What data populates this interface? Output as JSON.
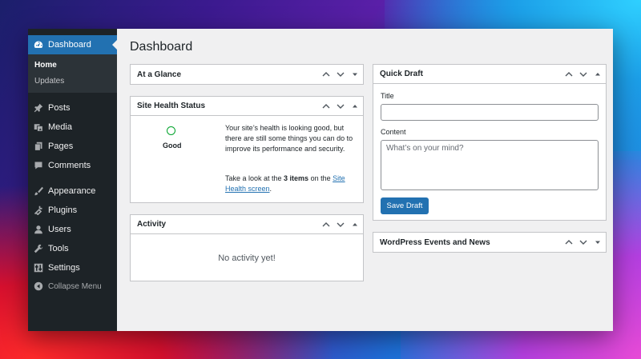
{
  "sidebar": {
    "dashboard_label": "Dashboard",
    "submenu": [
      {
        "label": "Home",
        "current": true
      },
      {
        "label": "Updates",
        "current": false
      }
    ],
    "items": [
      {
        "label": "Posts",
        "icon": "pin-icon"
      },
      {
        "label": "Media",
        "icon": "media-icon"
      },
      {
        "label": "Pages",
        "icon": "pages-icon"
      },
      {
        "label": "Comments",
        "icon": "comment-icon"
      },
      {
        "label": "Appearance",
        "icon": "brush-icon"
      },
      {
        "label": "Plugins",
        "icon": "plug-icon"
      },
      {
        "label": "Users",
        "icon": "user-icon"
      },
      {
        "label": "Tools",
        "icon": "wrench-icon"
      },
      {
        "label": "Settings",
        "icon": "settings-icon"
      }
    ],
    "collapse_label": "Collapse Menu"
  },
  "page": {
    "title": "Dashboard"
  },
  "widgets": {
    "glance": {
      "title": "At a Glance"
    },
    "health": {
      "title": "Site Health Status",
      "status": "Good",
      "message": "Your site’s health is looking good, but there are still some things you can do to improve its performance and security.",
      "link_prefix": "Take a look at the ",
      "items_count": "3 items",
      "link_mid": " on the ",
      "link_text": "Site Health screen",
      "link_suffix": "."
    },
    "activity": {
      "title": "Activity",
      "empty": "No activity yet!"
    },
    "quick_draft": {
      "title": "Quick Draft",
      "title_label": "Title",
      "title_value": "",
      "content_label": "Content",
      "content_placeholder": "What’s on your mind?",
      "save_label": "Save Draft"
    },
    "events": {
      "title": "WordPress Events and News"
    }
  },
  "colors": {
    "accent": "#2271b1",
    "sidebar": "#1d2327",
    "good": "#00a32a"
  }
}
